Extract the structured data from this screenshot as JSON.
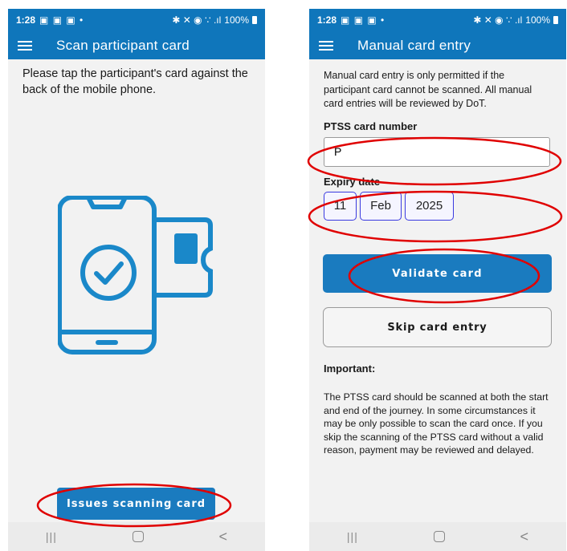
{
  "left_screen": {
    "status": {
      "time": "1:28",
      "notifications": "▣ ▣ ▣ •",
      "signal": "✱ ✕ ◉ ∵ .ıl",
      "battery": "100%"
    },
    "app_title": "Scan participant card",
    "instruction": "Please tap the participant's card against the back of the mobile phone.",
    "issues_button": "Issues scanning card",
    "nav": {
      "recent": "|||",
      "back": "<"
    }
  },
  "right_screen": {
    "status": {
      "time": "1:28",
      "notifications": "▣ ▣ ▣ •",
      "signal": "✱ ✕ ◉ ∵ .ıl",
      "battery": "100%"
    },
    "app_title": "Manual card entry",
    "info": "Manual card entry is only permitted if the participant card cannot be scanned. All manual card entries will be reviewed by DoT.",
    "card_number_label": "PTSS card number",
    "card_number_value": "P",
    "expiry_label": "Expiry date",
    "expiry": {
      "day": "11",
      "month": "Feb",
      "year": "2025"
    },
    "validate_button": "Validate card",
    "skip_button": "Skip card entry",
    "important_title": "Important:",
    "important_text": "The PTSS card should be scanned at both the start and end of the journey. In some circumstances it may be only possible to scan the card once. If you skip the scanning of the PTSS card without a valid reason, payment may be reviewed and delayed.",
    "nav": {
      "recent": "|||",
      "back": "<"
    }
  },
  "icons": [
    "menu-icon",
    "phone-card-tap-icon",
    "check-circle-icon",
    "battery-icon",
    "home-icon",
    "back-icon"
  ],
  "colors": {
    "brand": "#0f76bb",
    "button": "#1a7bbf",
    "annotation": "#e00000",
    "date_border": "#3a3ae0"
  }
}
